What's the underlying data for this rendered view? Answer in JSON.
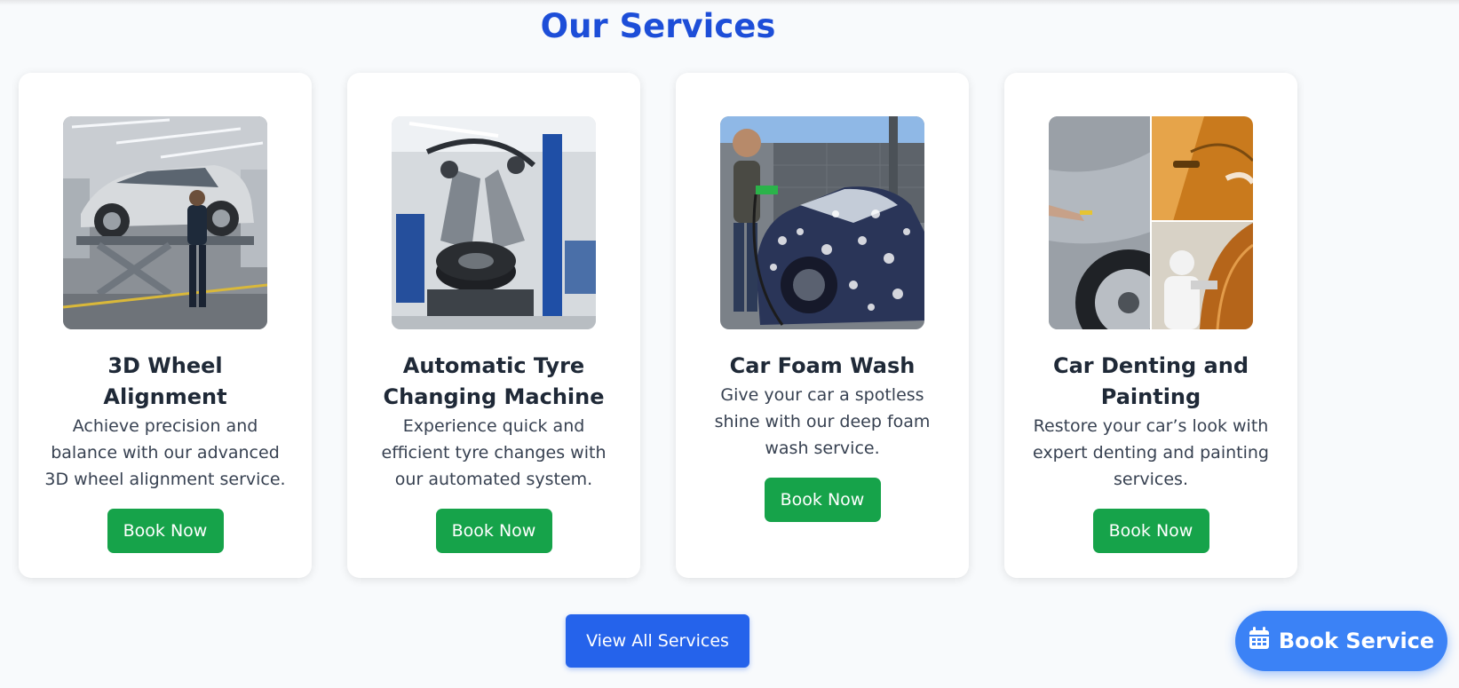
{
  "section": {
    "title": "Our Services"
  },
  "services": [
    {
      "title": "3D Wheel Alignment",
      "description": "Achieve precision and balance with our advanced 3D wheel alignment service.",
      "button": "Book Now"
    },
    {
      "title": "Automatic Tyre Changing Machine",
      "description": "Experience quick and efficient tyre changes with our automated system.",
      "button": "Book Now"
    },
    {
      "title": "Car Foam Wash",
      "description": "Give your car a spotless shine with our deep foam wash service.",
      "button": "Book Now"
    },
    {
      "title": "Car Denting and Painting",
      "description": "Restore your car’s look with expert denting and painting services.",
      "button": "Book Now"
    }
  ],
  "view_all": {
    "label": "View All Services"
  },
  "floating_button": {
    "label": "Book Service",
    "icon": "calendar-icon"
  },
  "colors": {
    "heading": "#1d4ed8",
    "book_button": "#16a34a",
    "view_all_button": "#2563eb",
    "floating_button": "#3b82f6",
    "background": "#f8fafc"
  }
}
